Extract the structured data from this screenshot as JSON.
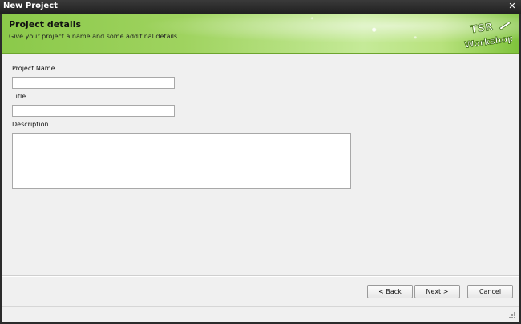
{
  "window": {
    "title": "New Project",
    "close_glyph": "✕"
  },
  "header": {
    "title": "Project details",
    "subtitle": "Give your project a name and some additinal details",
    "logo_line1": "TSR",
    "logo_line2": "Workshop",
    "accent": "#8bc94a"
  },
  "form": {
    "project_name_label": "Project Name",
    "project_name_value": "",
    "title_label": "Title",
    "title_value": "",
    "description_label": "Description",
    "description_value": ""
  },
  "buttons": {
    "back": "< Back",
    "next": "Next >",
    "cancel": "Cancel"
  },
  "icons": {
    "close": "close-icon",
    "logo": "tsr-workshop-logo",
    "grip": "resize-grip-icon"
  }
}
